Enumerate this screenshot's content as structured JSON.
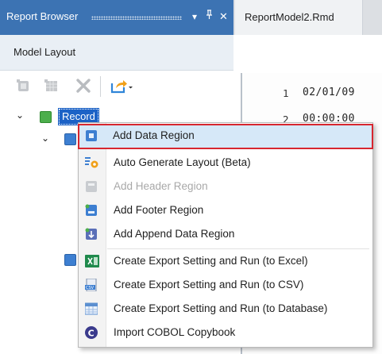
{
  "report_browser": {
    "title": "Report Browser",
    "pin_glyph": "↕",
    "dropdown_glyph": "▾",
    "close_glyph": "✕",
    "section_label": "Model Layout",
    "toolbar": {
      "icons": [
        "add-region-icon",
        "add-field-icon",
        "delete-icon",
        "export-icon"
      ]
    },
    "tree": {
      "expand_glyph": "⌄",
      "root_label": "Record",
      "root_color": "#4cae4c",
      "child_color": "#3d7fd1"
    }
  },
  "editor": {
    "tab_label": "ReportModel2.Rmd",
    "lines": [
      {
        "number": "1",
        "text": "02/01/09"
      },
      {
        "number": "2",
        "text": "00:00:00"
      }
    ]
  },
  "context_menu": {
    "highlight_color": "#d7262f",
    "items": [
      {
        "label": "Add Data Region",
        "icon": "data-region-icon",
        "enabled": true,
        "highlighted": true
      },
      {
        "label": "Auto Generate Layout (Beta)",
        "icon": "gear-layout-icon",
        "enabled": true
      },
      {
        "label": "Add Header Region",
        "icon": "header-region-icon",
        "enabled": false
      },
      {
        "label": "Add Footer Region",
        "icon": "footer-region-icon",
        "enabled": true
      },
      {
        "label": "Add Append Data Region",
        "icon": "append-region-icon",
        "enabled": true
      },
      {
        "label": "Create Export Setting and Run (to Excel)",
        "icon": "excel-icon",
        "enabled": true
      },
      {
        "label": "Create Export Setting and Run (to CSV)",
        "icon": "csv-icon",
        "enabled": true
      },
      {
        "label": "Create Export Setting and Run (to Database)",
        "icon": "database-table-icon",
        "enabled": true
      },
      {
        "label": "Import COBOL Copybook",
        "icon": "cobol-icon",
        "enabled": true
      }
    ]
  }
}
